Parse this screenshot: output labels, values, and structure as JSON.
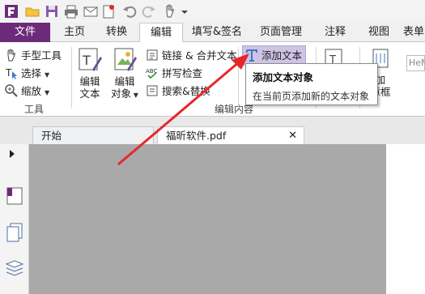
{
  "quick_access": {
    "icons": [
      "app-logo-icon",
      "open-folder-icon",
      "save-icon",
      "print-icon",
      "email-icon",
      "new-document-icon",
      "undo-icon",
      "redo-icon",
      "hand-tool-icon",
      "customize-dropdown-icon"
    ]
  },
  "tabs": [
    {
      "label": "文件"
    },
    {
      "label": "主页"
    },
    {
      "label": "转换"
    },
    {
      "label": "编辑"
    },
    {
      "label": "填写&签名"
    },
    {
      "label": "页面管理"
    },
    {
      "label": "注释"
    },
    {
      "label": "视图"
    },
    {
      "label": "表单"
    }
  ],
  "ribbon": {
    "tools_group": {
      "hand_tool": "手型工具",
      "select": "选择",
      "zoom": "缩放",
      "label": "工具"
    },
    "edit_text": {
      "line1": "编辑",
      "line2": "文本"
    },
    "edit_object": {
      "line1": "编辑",
      "line2": "对象"
    },
    "link_merge": "链接 & 合并文本",
    "spell_check": "拼写检查",
    "search_replace": "搜索&替换",
    "add_text": "添加文本",
    "edit_content_label": "编辑内容",
    "add_frame": {
      "line1": "加",
      "line2": "章框"
    },
    "font_box": "HeM"
  },
  "tooltip": {
    "title": "添加文本对象",
    "description": "在当前页添加新的文本对象"
  },
  "doc_tabs": [
    {
      "label": "开始"
    },
    {
      "label": "福昕软件.pdf"
    }
  ],
  "colors": {
    "file_tab": "#6d2a7a",
    "accent_purple": "#7b3b8c",
    "arrow_red": "#e8262b",
    "highlight": "#cfc3e6",
    "workspace": "#a9a9a9"
  }
}
